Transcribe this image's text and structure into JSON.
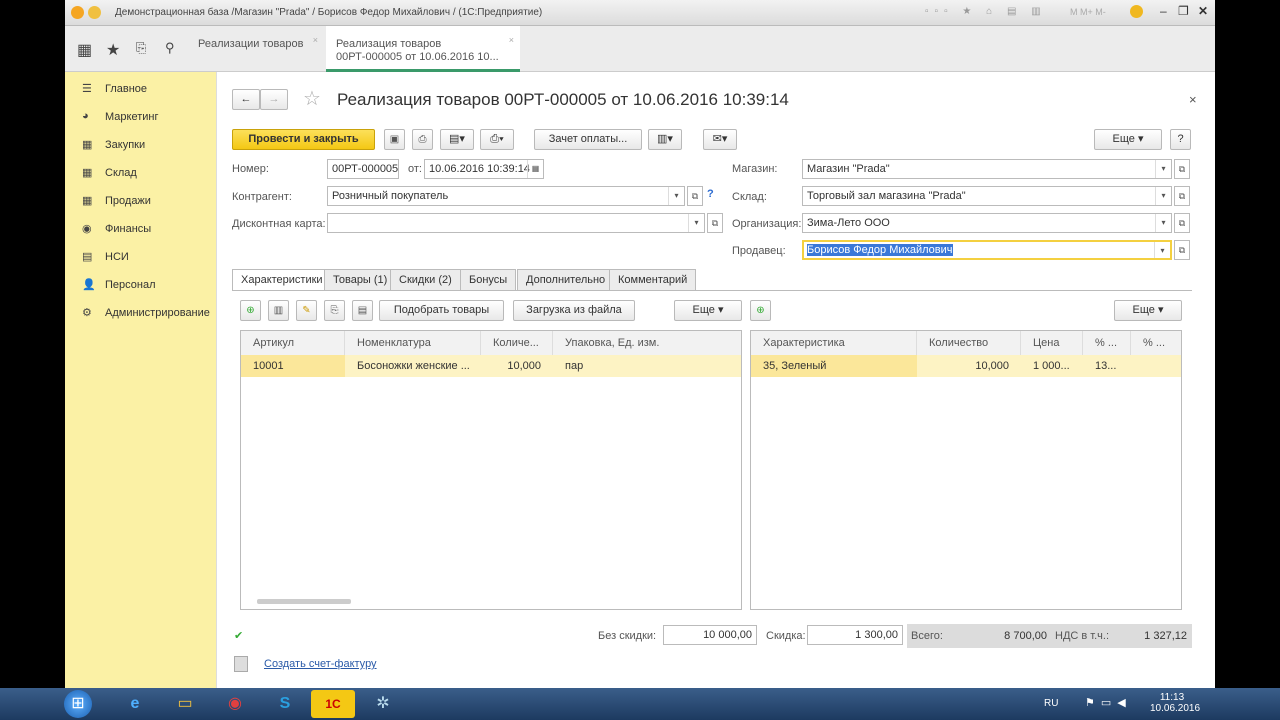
{
  "window": {
    "title": "Демонстрационная база /Магазин \"Prada\" / Борисов Федор Михайлович / (1С:Предприятие)",
    "toolbar_icons": [
      "save-icon",
      "print-icon",
      "doc-icon",
      "favorites-icon",
      "home-icon",
      "calendar-icon",
      "calculator-icon"
    ],
    "memory": [
      "M",
      "M+",
      "M-"
    ]
  },
  "open_tabs": [
    {
      "label": "Реализации товаров"
    },
    {
      "label": "Реализация товаров",
      "label2": "00РТ-000005 от 10.06.2016 10..."
    }
  ],
  "sidebar": {
    "items": [
      {
        "label": "Главное",
        "icon": "☰"
      },
      {
        "label": "Маркетинг",
        "icon": "◕"
      },
      {
        "label": "Закупки",
        "icon": "▦"
      },
      {
        "label": "Склад",
        "icon": "▦"
      },
      {
        "label": "Продажи",
        "icon": "▦"
      },
      {
        "label": "Финансы",
        "icon": "◉"
      },
      {
        "label": "НСИ",
        "icon": "▤"
      },
      {
        "label": "Персонал",
        "icon": "👤"
      },
      {
        "label": "Администрирование",
        "icon": "⚙"
      }
    ]
  },
  "doc": {
    "title": "Реализация товаров 00РТ-000005 от 10.06.2016 10:39:14",
    "buttons": {
      "post_close": "Провести и закрыть",
      "payment": "Зачет оплаты...",
      "more": "Еще",
      "help": "?"
    },
    "fields": {
      "number_label": "Номер:",
      "number": "00РТ-000005",
      "from_label": "от:",
      "date": "10.06.2016 10:39:14",
      "contractor_label": "Контрагент:",
      "contractor": "Розничный покупатель",
      "card_label": "Дисконтная карта:",
      "card": "",
      "store_label": "Магазин:",
      "store": "Магазин \"Prada\"",
      "warehouse_label": "Склад:",
      "warehouse": "Торговый зал магазина \"Prada\"",
      "org_label": "Организация:",
      "org": "Зима-Лето ООО",
      "seller_label": "Продавец:",
      "seller": "Борисов Федор Михайлович"
    },
    "tabs": [
      "Характеристики",
      "Товары (1)",
      "Скидки (2)",
      "Бонусы",
      "Дополнительно",
      "Комментарий"
    ],
    "left_toolbar": {
      "pick": "Подобрать товары",
      "load": "Загрузка из файла",
      "more": "Еще"
    },
    "right_toolbar": {
      "more": "Еще"
    },
    "left_table": {
      "columns": [
        "Артикул",
        "Номенклатура",
        "Количе...",
        "Упаковка, Ед. изм."
      ],
      "rows": [
        [
          "10001",
          "Босоножки женские ...",
          "10,000",
          "пар"
        ]
      ]
    },
    "right_table": {
      "columns": [
        "Характеристика",
        "Количество",
        "Цена",
        "% ...",
        "% ..."
      ],
      "rows": [
        [
          "35, Зеленый",
          "10,000",
          "1 000...",
          "13...",
          ""
        ]
      ]
    },
    "totals": {
      "no_discount_label": "Без скидки:",
      "no_discount": "10 000,00",
      "discount_label": "Скидка:",
      "discount": "1 300,00",
      "total_label": "Всего:",
      "total": "8 700,00",
      "vat_label": "НДС в т.ч.:",
      "vat": "1 327,12"
    },
    "invoice_link": "Создать счет-фактуру"
  },
  "taskbar": {
    "lang": "RU",
    "time": "11:13",
    "date": "10.06.2016"
  },
  "colors": {
    "accent": "#f4c814",
    "sidebar": "#fbf1a5",
    "row_selected": "#fdf3c4"
  }
}
